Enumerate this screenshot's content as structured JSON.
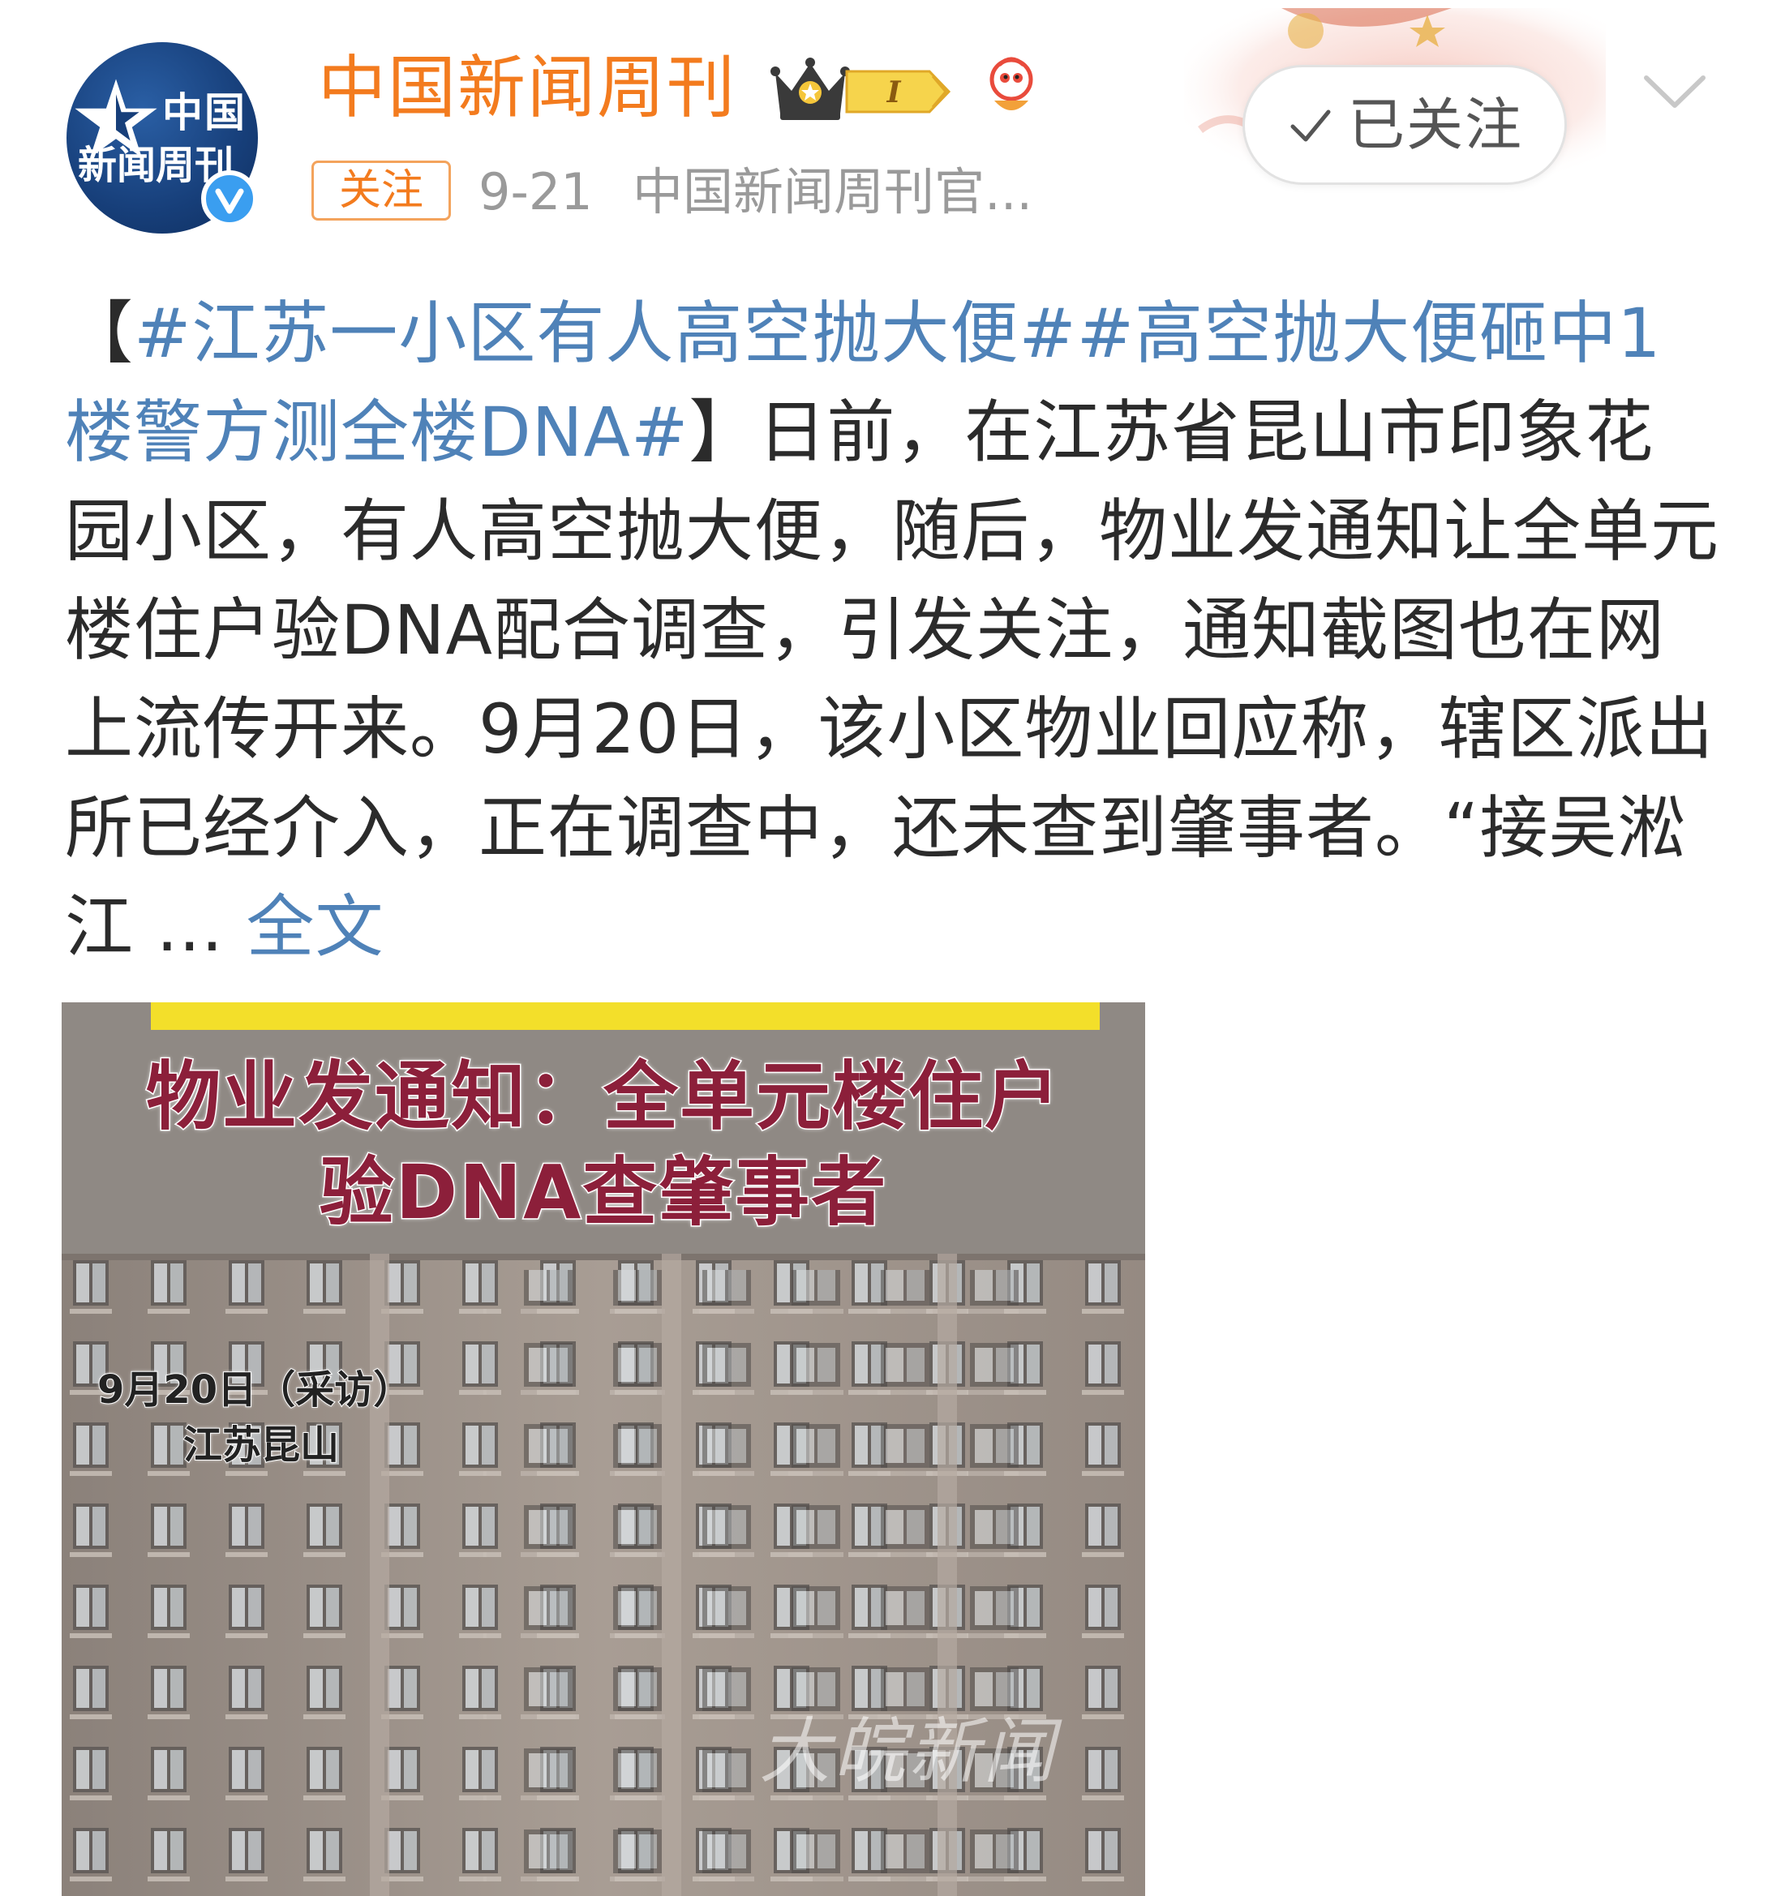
{
  "account": {
    "name": "中国新闻周刊",
    "avatar_line1": "中国",
    "avatar_line2": "新闻周刊",
    "level": "I",
    "follow_tag": "关注",
    "date": "9-21",
    "source": "中国新闻周刊官..."
  },
  "follow_button": {
    "label": "已关注"
  },
  "post": {
    "bracket_open": "【",
    "hashtag_1": "#江苏一小区有人高空抛大便#",
    "hashtag_2": "#高空抛大便砸中1楼警方测全楼DNA#",
    "bracket_close": "】",
    "text": "日前，在江苏省昆山市印象花园小区，有人高空抛大便，随后，物业发通知让全单元楼住户验DNA配合调查，引发关注，通知截图也在网上流传开来。9月20日，该小区物业回应称，辖区派出所已经介入，正在调查中，还未查到肇事者。“接吴淞江 ... ",
    "expand_label": "全文"
  },
  "image": {
    "caption_line1": "物业发通知：全单元楼住户",
    "caption_line2": "验DNA查肇事者",
    "date_label": "9月20日（采访）",
    "location_label": "江苏昆山",
    "watermark": "大皖新闻"
  },
  "colors": {
    "brand_orange": "#f37b1e",
    "link_blue": "#4f82b8",
    "muted_gray": "#9a9a9a",
    "verified_blue": "#3a9ef0",
    "caption_red": "#8c1f3a"
  },
  "icons": {
    "crown": "crown-icon",
    "mascot": "weibo-mascot-icon",
    "check": "check-icon",
    "chevron": "chevron-down-icon",
    "verified": "verified-icon"
  }
}
